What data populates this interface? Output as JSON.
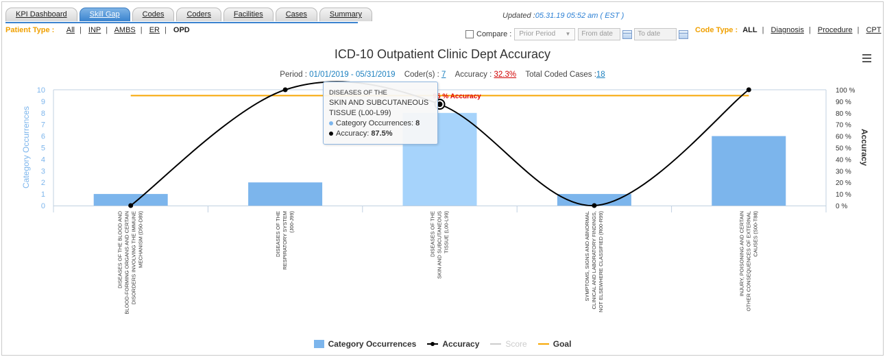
{
  "tabs": [
    {
      "label": "KPI Dashboard",
      "active": false
    },
    {
      "label": "Skill Gap",
      "active": true
    },
    {
      "label": "Codes",
      "active": false
    },
    {
      "label": "Coders",
      "active": false
    },
    {
      "label": "Facilities",
      "active": false
    },
    {
      "label": "Cases",
      "active": false
    },
    {
      "label": "Summary",
      "active": false
    }
  ],
  "updated": {
    "prefix": "Updated :",
    "timestamp": "05.31.19 05:52 am ( EST )"
  },
  "patient_type": {
    "label": "Patient Type :",
    "options": [
      "All",
      "INP",
      "AMBS",
      "ER",
      "OPD"
    ],
    "selected": "OPD"
  },
  "compare": {
    "label": "Compare :",
    "select_value": "Prior Period",
    "from_placeholder": "From date",
    "to_placeholder": "To date"
  },
  "code_type": {
    "label": "Code Type :",
    "options": [
      "ALL",
      "Diagnosis",
      "Procedure",
      "CPT"
    ],
    "selected": "ALL"
  },
  "chart_header": {
    "title": "ICD-10 Outpatient Clinic Dept Accuracy",
    "period_label": "Period :",
    "period_value": "01/01/2019 - 05/31/2019",
    "coders_label": "Coder(s) :",
    "coders_value": "7",
    "accuracy_label": "Accuracy :",
    "accuracy_value": "32.3%",
    "total_label": "Total Coded Cases :",
    "total_value": "18"
  },
  "chart_data": {
    "type": "bar",
    "categories": [
      "DISEASES OF THE BLOOD AND BLOOD-FORMING ORGANS AND CERTAIN DISORDERS INVOLVING THE IMMUNE MECHANISM (D50-D89)",
      "DISEASES OF THE RESPIRATORY SYSTEM (J00-J99)",
      "DISEASES OF THE SKIN AND SUBCUTANEOUS TISSUE (L00-L99)",
      "SYMPTOMS, SIGNS AND ABNORMAL CLINICAL AND LABORATORY FINDINGS, NOT ELSEWHERE CLASSIFIED (R00-R99)",
      "INJURY, POISONING AND CERTAIN OTHER CONSEQUENCES OF EXTERNAL CAUSES (S00-T88)"
    ],
    "category_lines": [
      [
        "DISEASES OF THE BLOOD AND",
        "BLOOD-FORMING ORGANS AND CERTAIN",
        "DISORDERS INVOLVING THE IMMUNE",
        "MECHANISM (D50-D89)"
      ],
      [
        "DISEASES OF THE",
        "RESPIRATORY SYSTEM",
        "(J00-J99)"
      ],
      [
        "DISEASES OF THE",
        "SKIN AND SUBCUTANEOUS",
        "TISSUE (L00-L99)"
      ],
      [
        "SYMPTOMS, SIGNS AND ABNORMAL",
        "CLINICAL AND LABORATORY FINDINGS,",
        "NOT ELSEWHERE CLASSIFIED (R00-R99)"
      ],
      [
        "INJURY, POISONING AND CERTAIN",
        "OTHER CONSEQUENCES OF EXTERNAL",
        "CAUSES (S00-T88)"
      ]
    ],
    "series": [
      {
        "name": "Category Occurrences",
        "type": "bar",
        "axis": "left",
        "values": [
          1,
          2,
          8,
          1,
          6
        ],
        "color": "#7cb5ec",
        "highlight_color": "#a6d3fb"
      },
      {
        "name": "Accuracy",
        "type": "spline",
        "axis": "right",
        "values": [
          0,
          100,
          87.5,
          0,
          100
        ],
        "color": "#000000"
      },
      {
        "name": "Score",
        "type": "line",
        "axis": "right",
        "values": [],
        "visible": false,
        "color": "#cccccc"
      },
      {
        "name": "Goal",
        "type": "line",
        "axis": "right",
        "values": [
          95,
          95,
          95,
          95,
          95
        ],
        "color": "#f7a600"
      }
    ],
    "goal_label": "95 % Accuracy",
    "ylabel": "Category Occurrences",
    "y2label": "Accuracy",
    "ylim": [
      0,
      10
    ],
    "y2lim": [
      0,
      100
    ],
    "y_ticks": [
      "0",
      "1",
      "2",
      "3",
      "4",
      "5",
      "6",
      "7",
      "8",
      "9",
      "10"
    ],
    "y2_ticks": [
      "0 %",
      "10 %",
      "20 %",
      "30 %",
      "40 %",
      "50 %",
      "60 %",
      "70 %",
      "80 %",
      "90 %",
      "100 %"
    ],
    "highlight_index": 2
  },
  "tooltip": {
    "line1": "DISEASES OF THE",
    "line2": "SKIN AND SUBCUTANEOUS",
    "line3": "TISSUE (L00-L99)",
    "occ_label": "Category Occurrences:",
    "occ_value": "8",
    "acc_label": "Accuracy:",
    "acc_value": "87.5%"
  },
  "legend": [
    {
      "label": "Category Occurrences"
    },
    {
      "label": "Accuracy"
    },
    {
      "label": "Score"
    },
    {
      "label": "Goal"
    }
  ],
  "colors": {
    "accent": "#3a83cf",
    "label_orange": "#f0a000",
    "link_blue": "#1a7fbf",
    "alert_red": "#d00000"
  }
}
